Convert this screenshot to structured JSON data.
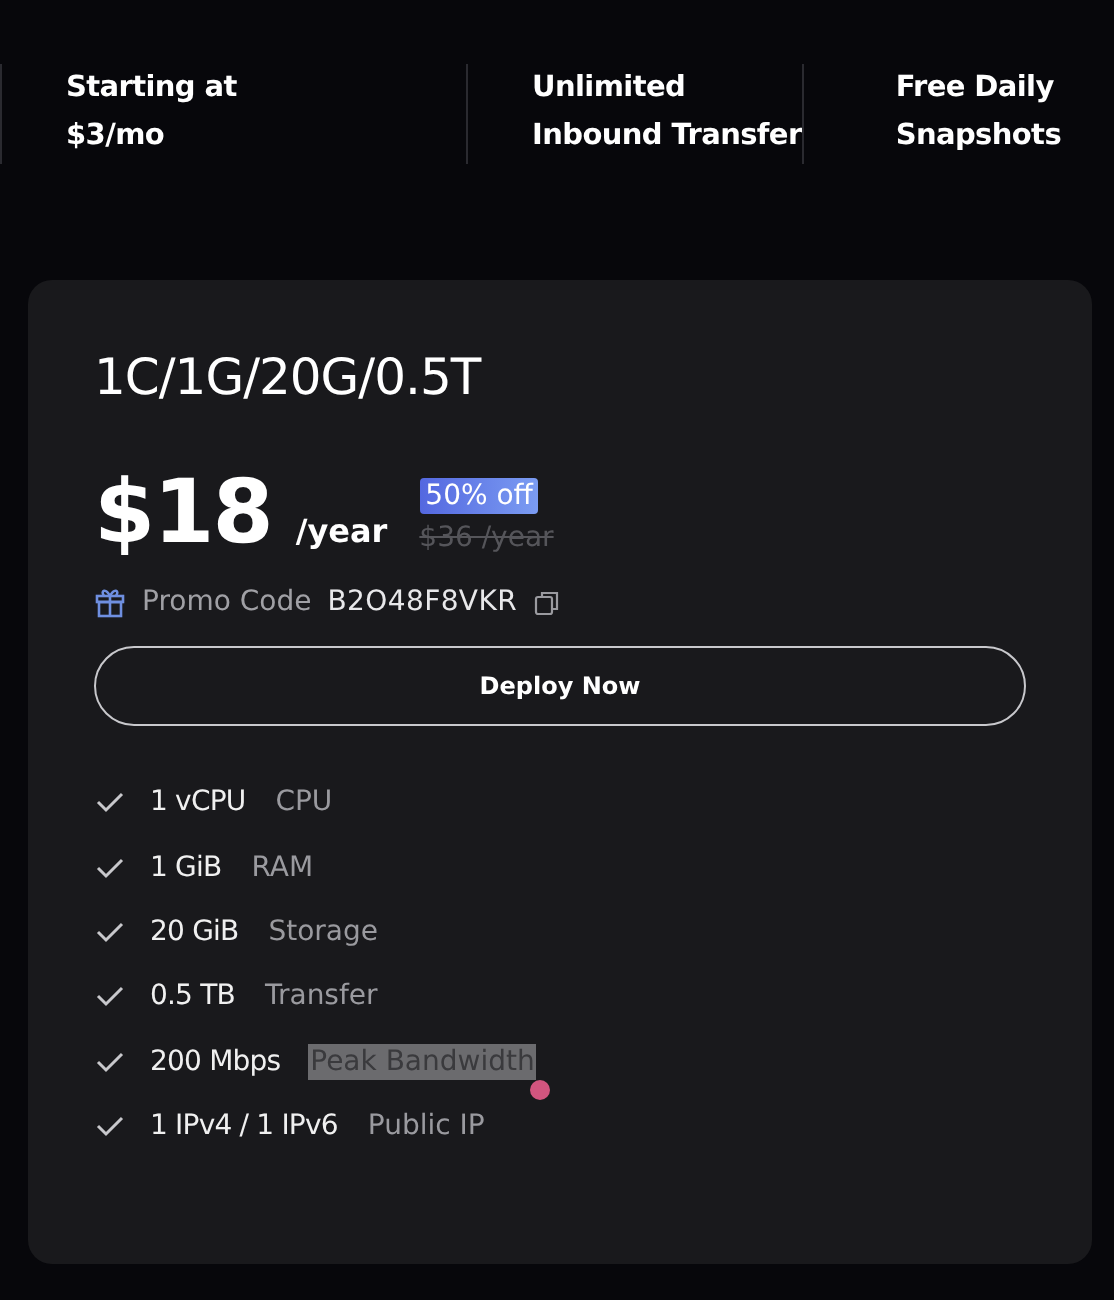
{
  "features": [
    {
      "line1": "Starting at",
      "line2": "$3/mo"
    },
    {
      "line1": "Unlimited",
      "line2": "Inbound Transfer"
    },
    {
      "line1": "Free Daily",
      "line2": "Snapshots"
    }
  ],
  "plan": {
    "name": "1C/1G/20G/0.5T",
    "price": "$18",
    "period": "/year",
    "discount": "50% off",
    "original_price": "$36 /year",
    "promo_label": "Promo Code",
    "promo_code": "B2O48F8VKR",
    "button": "Deploy Now",
    "specs": [
      {
        "value": "1 vCPU",
        "label": "CPU",
        "highlighted": false
      },
      {
        "value": "1 GiB",
        "label": "RAM",
        "highlighted": false
      },
      {
        "value": "20 GiB",
        "label": "Storage",
        "highlighted": false
      },
      {
        "value": "0.5 TB",
        "label": "Transfer",
        "highlighted": false
      },
      {
        "value": "200 Mbps",
        "label": "Peak Bandwidth",
        "highlighted": true
      },
      {
        "value": "1 IPv4 / 1 IPv6",
        "label": "Public IP",
        "highlighted": false
      }
    ]
  }
}
